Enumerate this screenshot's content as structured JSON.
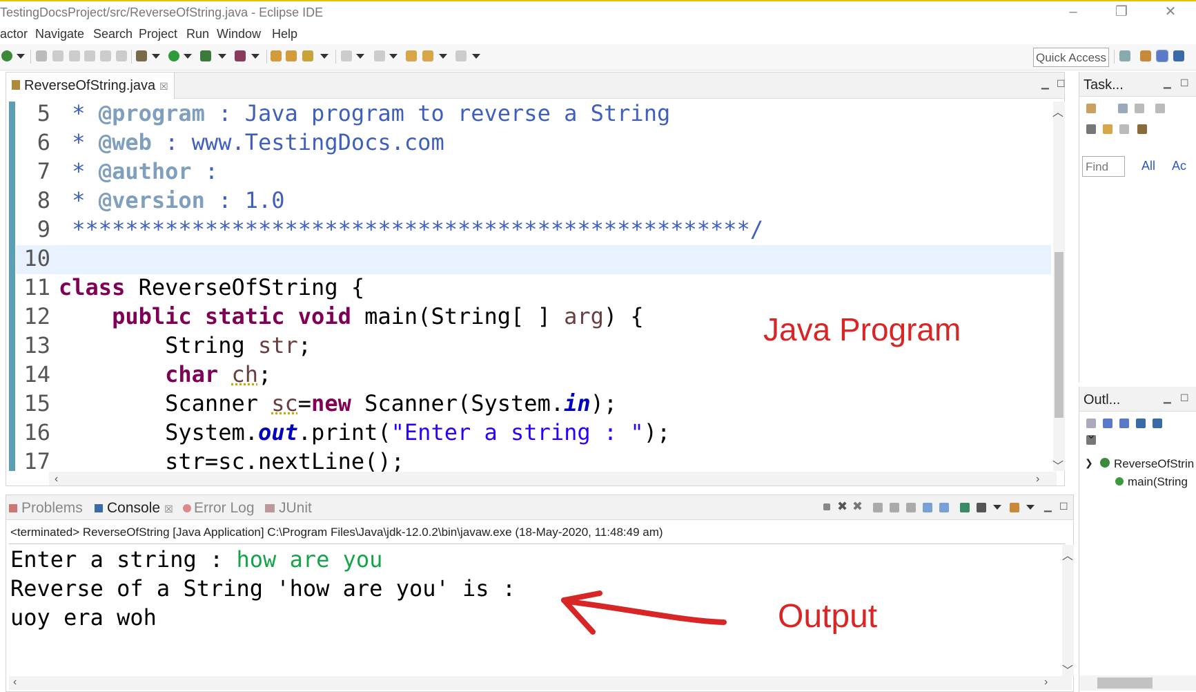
{
  "window": {
    "title": "TestingDocsProject/src/ReverseOfString.java - Eclipse IDE"
  },
  "menu": [
    "actor",
    "Navigate",
    "Search",
    "Project",
    "Run",
    "Window",
    "Help"
  ],
  "toolbar": {
    "quick_access": "Quick Access",
    "icons": [
      "new-icon",
      "build-icon",
      "debug-icon",
      "run-icon",
      "coverage-icon",
      "external-tools-icon",
      "open-type-icon",
      "search-icon",
      "annotation-icon",
      "back-icon",
      "forward-icon"
    ]
  },
  "editor": {
    "tab_label": "ReverseOfString.java",
    "tab_close": "☒",
    "lines": [
      {
        "n": "5",
        "tokens": [
          {
            "c": "cm",
            "t": " * "
          },
          {
            "c": "cmtag",
            "t": "@program"
          },
          {
            "c": "cm",
            "t": " : Java program to reverse a String"
          }
        ]
      },
      {
        "n": "6",
        "tokens": [
          {
            "c": "cm",
            "t": " * "
          },
          {
            "c": "cmtag",
            "t": "@web"
          },
          {
            "c": "cm",
            "t": " : www.TestingDocs.com"
          }
        ]
      },
      {
        "n": "7",
        "tokens": [
          {
            "c": "cm",
            "t": " * "
          },
          {
            "c": "cmtag",
            "t": "@author"
          },
          {
            "c": "cm",
            "t": " :"
          }
        ]
      },
      {
        "n": "8",
        "tokens": [
          {
            "c": "cm",
            "t": " * "
          },
          {
            "c": "cmtag",
            "t": "@version"
          },
          {
            "c": "cm",
            "t": " : 1.0"
          }
        ]
      },
      {
        "n": "9",
        "tokens": [
          {
            "c": "cm",
            "t": " ***************************************************/"
          }
        ]
      },
      {
        "n": "10",
        "current": true,
        "tokens": []
      },
      {
        "n": "11",
        "tokens": [
          {
            "c": "kw",
            "t": "class"
          },
          {
            "c": "tx",
            "t": " ReverseOfString {"
          }
        ]
      },
      {
        "n": "12",
        "tokens": [
          {
            "c": "tx",
            "t": "    "
          },
          {
            "c": "kw",
            "t": "public static void"
          },
          {
            "c": "tx",
            "t": " main(String[ ] "
          },
          {
            "c": "vr",
            "t": "arg"
          },
          {
            "c": "tx",
            "t": ") {"
          }
        ]
      },
      {
        "n": "13",
        "tokens": [
          {
            "c": "tx",
            "t": "        String "
          },
          {
            "c": "vr",
            "t": "str"
          },
          {
            "c": "tx",
            "t": ";"
          }
        ]
      },
      {
        "n": "14",
        "tokens": [
          {
            "c": "tx",
            "t": "        "
          },
          {
            "c": "kw",
            "t": "char"
          },
          {
            "c": "tx",
            "t": " "
          },
          {
            "c": "vr ul",
            "t": "ch"
          },
          {
            "c": "tx",
            "t": ";"
          }
        ]
      },
      {
        "n": "15",
        "tokens": [
          {
            "c": "tx",
            "t": "        Scanner "
          },
          {
            "c": "vr ul",
            "t": "sc"
          },
          {
            "c": "tx",
            "t": "="
          },
          {
            "c": "kw",
            "t": "new"
          },
          {
            "c": "tx",
            "t": " Scanner(System."
          },
          {
            "c": "fl",
            "t": "in"
          },
          {
            "c": "tx",
            "t": ");"
          }
        ]
      },
      {
        "n": "16",
        "tokens": [
          {
            "c": "tx",
            "t": "        System."
          },
          {
            "c": "fl",
            "t": "out"
          },
          {
            "c": "tx",
            "t": ".print("
          },
          {
            "c": "st",
            "t": "\"Enter a string : \""
          },
          {
            "c": "tx",
            "t": ");"
          }
        ]
      },
      {
        "n": "17",
        "tokens": [
          {
            "c": "tx",
            "t": "        str=sc.nextLine();"
          }
        ]
      }
    ],
    "annotation": "Java Program"
  },
  "task_view": {
    "title": "Task...",
    "find_placeholder": "Find",
    "filter_all": "All",
    "filter_activate": "Ac"
  },
  "outline_view": {
    "title": "Outl...",
    "class_node": "ReverseOfStrin",
    "method_node": "main(String"
  },
  "console": {
    "tabs": [
      {
        "label": "Problems",
        "active": false
      },
      {
        "label": "Console",
        "active": true
      },
      {
        "label": "Error Log",
        "active": false
      },
      {
        "label": "JUnit",
        "active": false
      }
    ],
    "status": "<terminated> ReverseOfString [Java Application] C:\\Program Files\\Java\\jdk-12.0.2\\bin\\javaw.exe (18-May-2020, 11:48:49 am)",
    "prompt": "Enter a string : ",
    "user_input": "how are you",
    "result_line": "Reverse of a String 'how are you' is :",
    "reversed": "uoy era woh",
    "annotation": "Output"
  },
  "colors": {
    "annotation": "#d82626",
    "keyword": "#7f0055",
    "comment": "#3f5fbf",
    "string": "#2a00ff",
    "console_input": "#17a34a"
  }
}
